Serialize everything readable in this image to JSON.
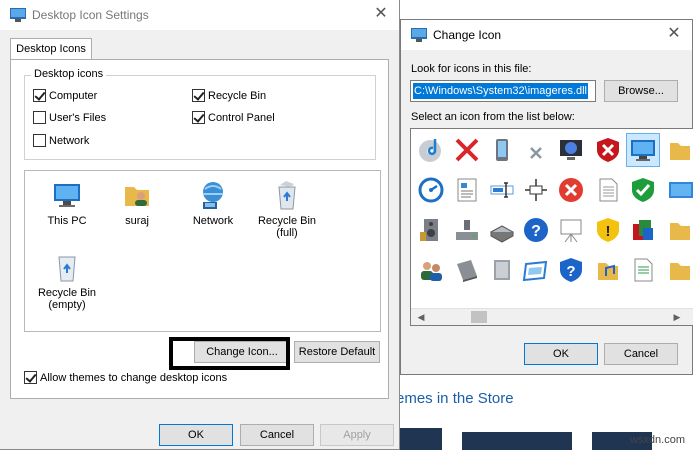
{
  "background": {
    "store_text": "emes in the Store",
    "watermark": "wsxdn.com"
  },
  "main_dialog": {
    "title": "Desktop Icon Settings",
    "tab_label": "Desktop Icons",
    "group_label": "Desktop icons",
    "checkboxes": [
      {
        "label": "Computer",
        "checked": true
      },
      {
        "label": "User's Files",
        "checked": false
      },
      {
        "label": "Network",
        "checked": false
      },
      {
        "label": "Recycle Bin",
        "checked": true
      },
      {
        "label": "Control Panel",
        "checked": true
      }
    ],
    "icons": [
      {
        "label": "This PC",
        "icon": "this-pc-icon"
      },
      {
        "label": "suraj",
        "icon": "user-folder-icon"
      },
      {
        "label": "Network",
        "icon": "network-icon"
      },
      {
        "label": "Recycle Bin\n(full)",
        "icon": "recycle-bin-full-icon"
      },
      {
        "label": "Recycle Bin\n(empty)",
        "icon": "recycle-bin-empty-icon"
      }
    ],
    "change_icon_label": "Change Icon...",
    "restore_default_label": "Restore Default",
    "allow_themes_label": "Allow themes to change desktop icons",
    "allow_themes_checked": true,
    "ok_label": "OK",
    "cancel_label": "Cancel",
    "apply_label": "Apply"
  },
  "change_dialog": {
    "title": "Change Icon",
    "look_label": "Look for icons in this file:",
    "path_value": "C:\\Windows\\System32\\imageres.dll",
    "browse_label": "Browse...",
    "select_label": "Select an icon from the list below:",
    "ok_label": "OK",
    "cancel_label": "Cancel"
  }
}
